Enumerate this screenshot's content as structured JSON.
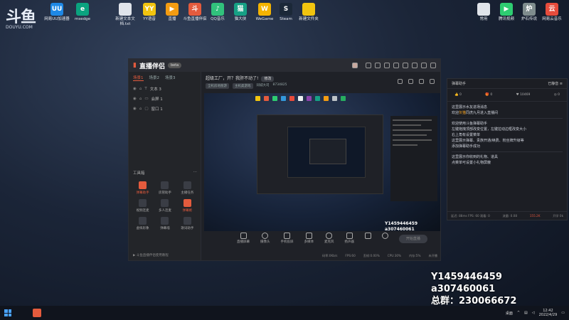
{
  "desktop": {
    "logo": {
      "big": "斗鱼",
      "small": "DOUYU.COM"
    },
    "icons": [
      {
        "label": "网易UU加速器",
        "color": "#1e88e5",
        "glyph": "UU"
      },
      {
        "label": "msedge",
        "color": "#0aa37f",
        "glyph": "e"
      },
      {
        "label": "新建文本文档.txt",
        "color": "#e0e4ea",
        "glyph": ""
      },
      {
        "label": "YY语音",
        "color": "#f1c40f",
        "glyph": "YY"
      },
      {
        "label": "直播",
        "color": "#f39c12",
        "glyph": "▶"
      },
      {
        "label": "斗鱼直播伴侣",
        "color": "#e45b3d",
        "glyph": "斗"
      },
      {
        "label": "QQ音乐",
        "color": "#31c27c",
        "glyph": "♪"
      },
      {
        "label": "猫大侠",
        "color": "#16a085",
        "glyph": "猫"
      },
      {
        "label": "WeGame",
        "color": "#f5b400",
        "glyph": "W"
      },
      {
        "label": "Steam",
        "color": "#1b2838",
        "glyph": "S"
      },
      {
        "label": "新建文件夹",
        "color": "#f1c40f",
        "glyph": ""
      }
    ],
    "right_icons": [
      {
        "label": "常用",
        "color": "#e0e4ea",
        "glyph": ""
      },
      {
        "label": "腾讯视频",
        "color": "#2ecc71",
        "glyph": "▶"
      },
      {
        "label": "炉石传说",
        "color": "#7f8c8d",
        "glyph": "炉"
      },
      {
        "label": "网易云音乐",
        "color": "#e74c3c",
        "glyph": "云"
      }
    ]
  },
  "app": {
    "brand": "直播伴侣",
    "beta": "beta",
    "scene_tabs": [
      "场景1",
      "场景2",
      "场景3"
    ],
    "sources": [
      {
        "name": "文本 3"
      },
      {
        "name": "会屏 1"
      },
      {
        "name": "窗口 1"
      }
    ],
    "toolbox_title": "工具箱",
    "tools": [
      {
        "label": "弹幕助手",
        "hot": true
      },
      {
        "label": "房管助手",
        "hot": false
      },
      {
        "label": "主播任务",
        "hot": false
      },
      {
        "label": "视频连麦",
        "hot": false
      },
      {
        "label": "多人连麦",
        "hot": false
      },
      {
        "label": "弹幕姬",
        "hot": true
      },
      {
        "label": "虚拟形象",
        "hot": false
      },
      {
        "label": "弹幕墙",
        "hot": false
      },
      {
        "label": "歌词助手",
        "hot": false
      }
    ],
    "hint": "斗鱼直播伴侣使用教程",
    "room": {
      "title": "超级工厂，开？我肝不动了!",
      "tag": "修改",
      "meta": [
        "全机房地图游",
        "主机类游戏",
        "同城大司",
        "8734825"
      ]
    },
    "overlay": [
      "Y1459446459",
      "a307460061",
      "总群：230066672"
    ],
    "controls": [
      "直播屏幕",
      "摄像头",
      "手机投屏",
      "多媒体",
      "麦克风",
      "扬声器"
    ],
    "start_label": "开始直播",
    "status": [
      "码率:0Kb/s",
      "FPS:60",
      "丢帧:0.00%",
      "CPU:30%",
      "内存:5%",
      "未开播"
    ]
  },
  "barrage": {
    "title": "弹幕助手",
    "settings": "已静音",
    "stats": [
      "0",
      "0",
      "10469",
      "0"
    ],
    "messages": [
      {
        "text": "这里展示水友进场消息",
        "hl": ""
      },
      {
        "text": "欢迎",
        "hl": "灰猫",
        "rest": "同虎九月进入直播间"
      },
      {
        "text": "",
        "hl": "",
        "sep": true
      },
      {
        "text": "欢迎使用斗鱼弹幕助手",
        "hl": ""
      },
      {
        "text": "左键拖拽顶部改变位置，左键拉动边框改变大小",
        "hl": ""
      },
      {
        "text": "右上角有设置菜单",
        "hl": ""
      },
      {
        "text": "这里展示弹幕、贵族开通/续费、粉丝牌升级等",
        "hl": ""
      },
      {
        "text": "添加弹幕助手成功",
        "hl": ""
      },
      {
        "text": "",
        "hl": "",
        "sep": true
      },
      {
        "text": "这里展示你收到的礼物、道具",
        "hl": ""
      },
      {
        "text": "点菜单可设置小礼物屏蔽",
        "hl": ""
      }
    ],
    "footer_left": "延迟: 88ms  FPS: 60  观看: 0",
    "footer_mid": "流量: 0.08",
    "footer_red": "155.2K",
    "footer_right": "开学 0k"
  },
  "taskbar": {
    "tray_label": "桌面",
    "time": "12:42",
    "date": "2022/4/29"
  }
}
